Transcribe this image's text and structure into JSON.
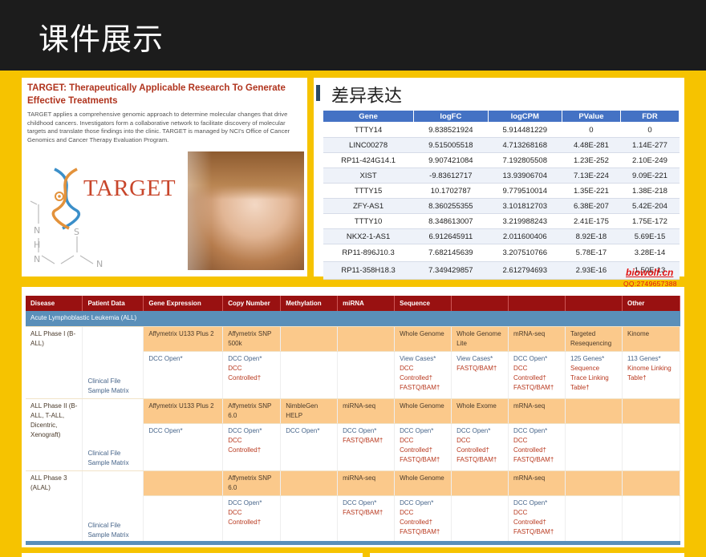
{
  "slide": {
    "title": "课件展示"
  },
  "target": {
    "heading": "TARGET: Therapeutically Applicable Research To Generate Effective Treatments",
    "description": "TARGET applies a comprehensive genomic approach to determine molecular changes that drive childhood cancers. Investigators form a collaborative network to facilitate discovery of molecular targets and translate those findings into the clinic. TARGET is managed by NCI's Office of Cancer Genomics and Cancer Therapy Evaluation Program.",
    "logo_text": "TARGET",
    "chem_letters": [
      "N",
      "H",
      "N",
      "S",
      "N"
    ]
  },
  "de": {
    "title": "差异表达",
    "headers": [
      "Gene",
      "logFC",
      "logCPM",
      "PValue",
      "FDR"
    ],
    "rows": [
      [
        "TTTY14",
        "9.838521924",
        "5.914481229",
        "0",
        "0"
      ],
      [
        "LINC00278",
        "9.515005518",
        "4.713268168",
        "4.48E-281",
        "1.14E-277"
      ],
      [
        "RP11-424G14.1",
        "9.907421084",
        "7.192805508",
        "1.23E-252",
        "2.10E-249"
      ],
      [
        "XIST",
        "-9.83612717",
        "13.93906704",
        "7.13E-224",
        "9.09E-221"
      ],
      [
        "TTTY15",
        "10.1702787",
        "9.779510014",
        "1.35E-221",
        "1.38E-218"
      ],
      [
        "ZFY-AS1",
        "8.360255355",
        "3.101812703",
        "6.38E-207",
        "5.42E-204"
      ],
      [
        "TTTY10",
        "8.348613007",
        "3.219988243",
        "2.41E-175",
        "1.75E-172"
      ],
      [
        "NKX2-1-AS1",
        "6.912645911",
        "2.011600406",
        "8.92E-18",
        "5.69E-15"
      ],
      [
        "RP11-896J10.3",
        "7.682145639",
        "3.207510766",
        "5.78E-17",
        "3.28E-14"
      ],
      [
        "RP11-358H18.3",
        "7.349429857",
        "2.612794693",
        "2.93E-16",
        "1.50E-13"
      ]
    ]
  },
  "watermark": {
    "site": "biowolf.cn",
    "qq": "QQ:2749657388"
  },
  "grid": {
    "headers": [
      "Disease",
      "Patient Data",
      "Gene Expression",
      "Copy Number",
      "Methylation",
      "miRNA",
      "Sequence",
      "",
      "",
      "",
      "Other"
    ],
    "section": "Acute Lymphoblastic Leukemia (ALL)",
    "phases": [
      {
        "name": "ALL Phase I (B-ALL)",
        "patient": [
          "Clinical File",
          "Sample Matrix"
        ],
        "platforms": [
          "Affymetrix U133 Plus 2",
          "Affymetrix SNP 500k",
          "",
          "",
          "Whole Genome",
          "Whole Genome Lite",
          "mRNA-seq",
          "Targeted Resequencing",
          "Kinome"
        ],
        "access": [
          [
            [
              "DCC Open*",
              "o"
            ]
          ],
          [
            [
              "DCC Open*",
              "o"
            ],
            [
              "DCC Controlled†",
              "c"
            ]
          ],
          [],
          [],
          [
            [
              "View Cases*",
              "o"
            ],
            [
              "DCC Controlled†",
              "c"
            ],
            [
              "FASTQ/BAM†",
              "c"
            ]
          ],
          [
            [
              "View Cases*",
              "o"
            ],
            [
              "FASTQ/BAM†",
              "c"
            ]
          ],
          [
            [
              "DCC Open*",
              "o"
            ],
            [
              "DCC Controlled†",
              "c"
            ],
            [
              "FASTQ/BAM†",
              "c"
            ]
          ],
          [
            [
              "125 Genes*",
              "o"
            ],
            [
              "Sequence Trace Linking Table†",
              "c"
            ]
          ],
          [
            [
              "113 Genes*",
              "o"
            ],
            [
              "Kinome Linking Table†",
              "c"
            ]
          ]
        ]
      },
      {
        "name": "ALL Phase II (B-ALL, T-ALL, Dicentric, Xenograft)",
        "patient": [
          "Clinical File",
          "Sample Matrix"
        ],
        "platforms": [
          "Affymetrix U133 Plus 2",
          "Affymetrix SNP 6.0",
          "NimbleGen HELP",
          "miRNA-seq",
          "Whole Genome",
          "Whole Exome",
          "mRNA-seq",
          "",
          ""
        ],
        "access": [
          [
            [
              "DCC Open*",
              "o"
            ]
          ],
          [
            [
              "DCC Open*",
              "o"
            ],
            [
              "DCC Controlled†",
              "c"
            ]
          ],
          [
            [
              "DCC Open*",
              "o"
            ]
          ],
          [
            [
              "DCC Open*",
              "o"
            ],
            [
              "FASTQ/BAM†",
              "c"
            ]
          ],
          [
            [
              "DCC Open*",
              "o"
            ],
            [
              "DCC Controlled†",
              "c"
            ],
            [
              "FASTQ/BAM†",
              "c"
            ]
          ],
          [
            [
              "DCC Open*",
              "o"
            ],
            [
              "DCC Controlled†",
              "c"
            ],
            [
              "FASTQ/BAM†",
              "c"
            ]
          ],
          [
            [
              "DCC Open*",
              "o"
            ],
            [
              "DCC Controlled†",
              "c"
            ],
            [
              "FASTQ/BAM†",
              "c"
            ]
          ],
          [],
          []
        ]
      },
      {
        "name": "ALL Phase 3 (ALAL)",
        "patient": [
          "Clinical File",
          "Sample Matrix"
        ],
        "platforms": [
          "",
          "Affymetrix SNP 6.0",
          "",
          "miRNA-seq",
          "Whole Genome",
          "",
          "mRNA-seq",
          "",
          ""
        ],
        "access": [
          [],
          [
            [
              "DCC Open*",
              "o"
            ],
            [
              "DCC Controlled†",
              "c"
            ]
          ],
          [],
          [
            [
              "DCC Open*",
              "o"
            ],
            [
              "FASTQ/BAM†",
              "c"
            ]
          ],
          [
            [
              "DCC Open*",
              "o"
            ],
            [
              "DCC Controlled†",
              "c"
            ],
            [
              "FASTQ/BAM†",
              "c"
            ]
          ],
          [],
          [
            [
              "DCC Open*",
              "o"
            ],
            [
              "DCC Controlled†",
              "c"
            ],
            [
              "FASTQ/BAM†",
              "c"
            ]
          ],
          [],
          []
        ]
      }
    ]
  }
}
